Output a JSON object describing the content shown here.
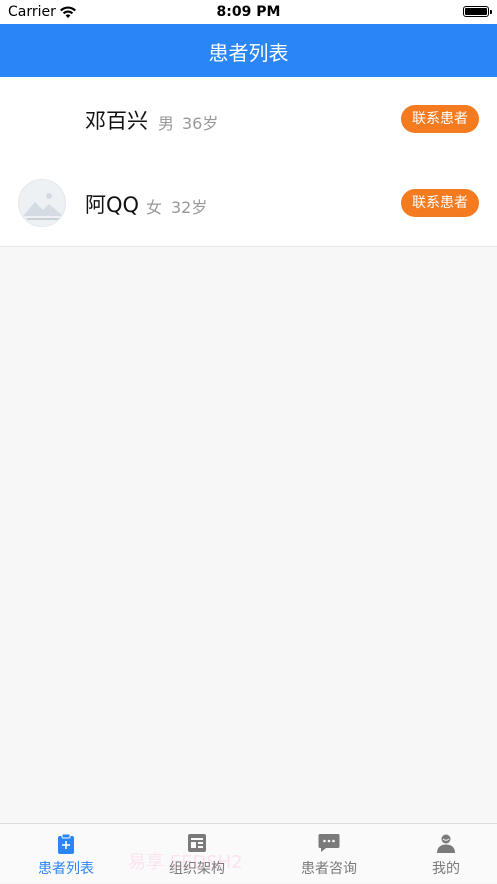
{
  "status_bar": {
    "carrier": "Carrier",
    "time": "8:09 PM"
  },
  "nav": {
    "title": "患者列表"
  },
  "patients": [
    {
      "name": "邓百兴",
      "gender": "男",
      "age": "36岁",
      "contact_label": "联系患者",
      "has_avatar": false
    },
    {
      "name": "阿QQ",
      "gender": "女",
      "age": "32岁",
      "contact_label": "联系患者",
      "has_avatar": true
    }
  ],
  "tab_bar": {
    "tabs": [
      {
        "label": "患者列表",
        "icon": "clipboard-icon",
        "active": true
      },
      {
        "label": "组织架构",
        "icon": "org-icon",
        "active": false
      },
      {
        "label": "患者咨询",
        "icon": "chat-icon",
        "active": false
      },
      {
        "label": "我的",
        "icon": "person-icon",
        "active": false
      }
    ]
  },
  "watermark": "易享 EEDSH2",
  "colors": {
    "primary": "#2a85f7",
    "accent": "#f47b20",
    "inactive_tab": "#7a7a7a"
  }
}
